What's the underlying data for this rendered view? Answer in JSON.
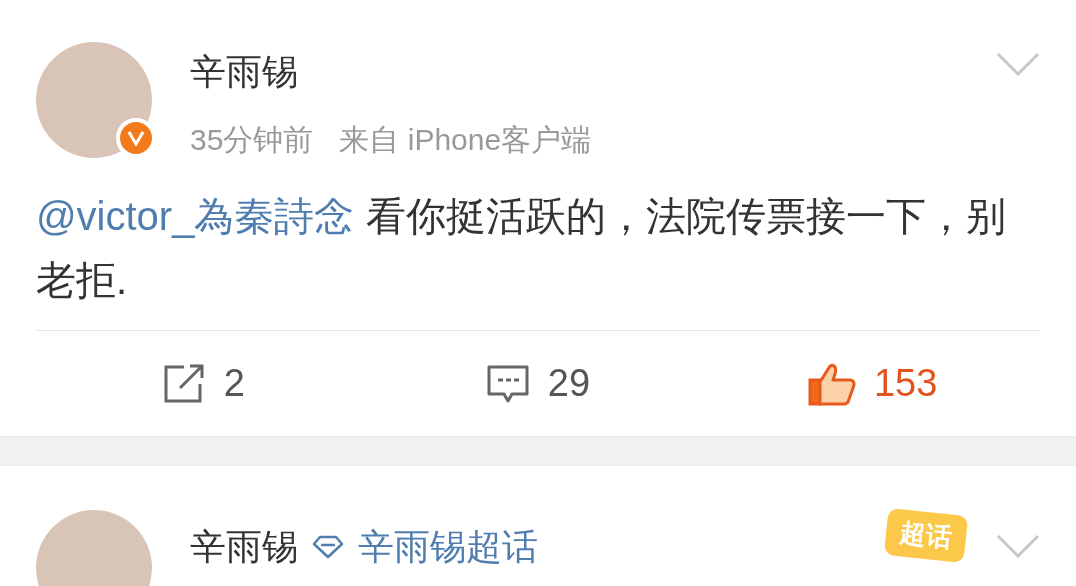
{
  "posts": [
    {
      "author": "辛雨锡",
      "verified": true,
      "time": "35分钟前",
      "source": "来自 iPhone客户端",
      "mention": "@victor_為秦詩念",
      "text": " 看你挺活跃的，法院传票接一下，别老拒.",
      "actions": [
        {
          "kind": "repost",
          "count": "2"
        },
        {
          "kind": "comment",
          "count": "29"
        },
        {
          "kind": "like",
          "count": "153",
          "liked": true
        }
      ]
    },
    {
      "author": "辛雨锡",
      "topic": "辛雨锡超话",
      "badge": "超话"
    }
  ]
}
